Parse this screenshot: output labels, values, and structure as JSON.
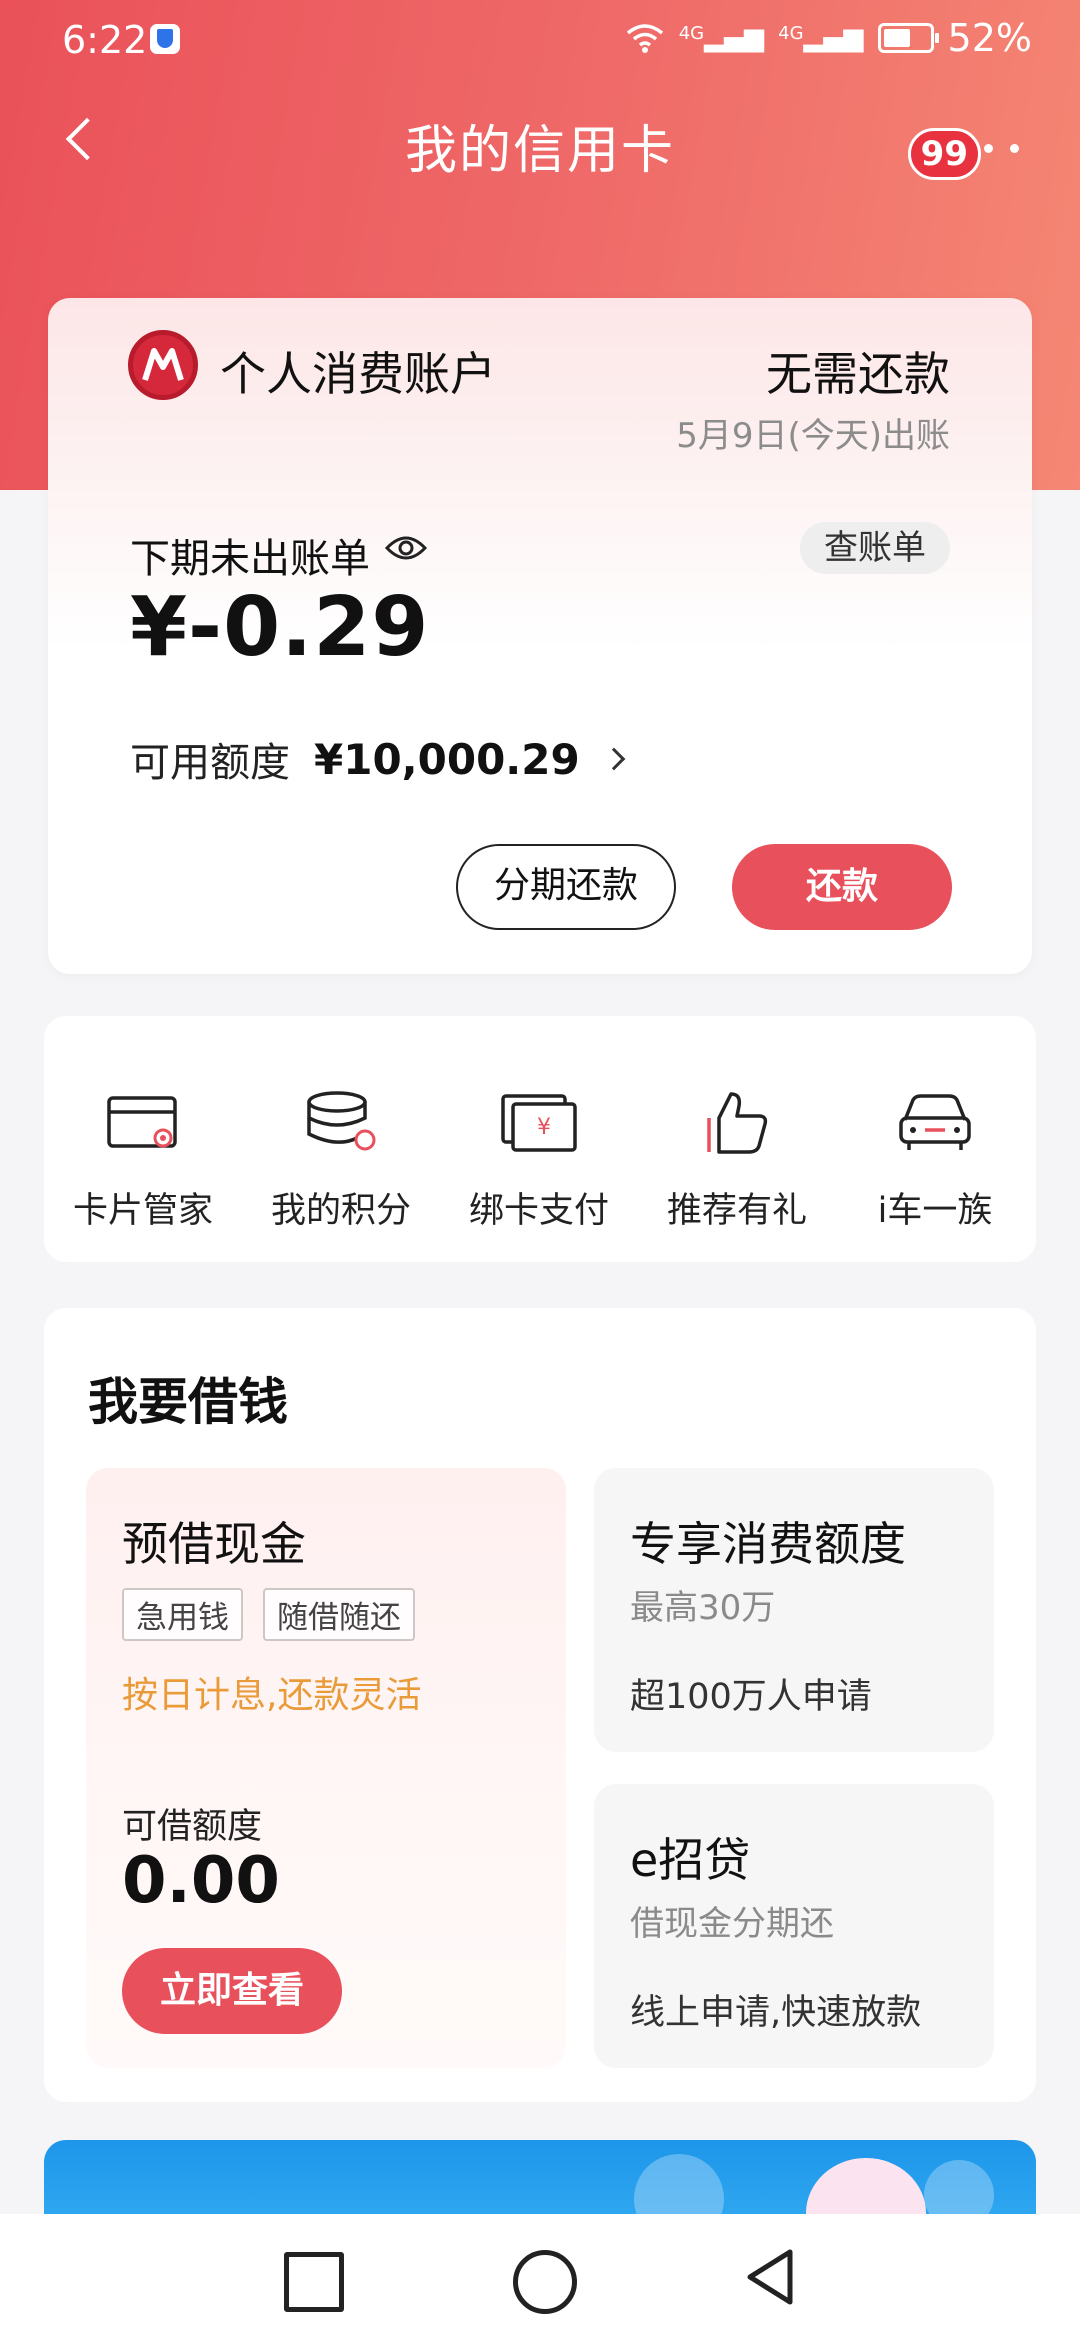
{
  "status_bar": {
    "time": "6:22",
    "network_1": "4G",
    "network_2": "4G",
    "battery_percent": "52%"
  },
  "header": {
    "title": "我的信用卡",
    "badge_count": "99"
  },
  "account": {
    "name": "个人消费账户",
    "repay_status": "无需还款",
    "bill_date": "5月9日(今天)出账",
    "unbilled_label": "下期未出账单",
    "statement_button": "查账单",
    "balance": "¥-0.29",
    "credit_label": "可用额度",
    "credit_value": "¥10,000.29",
    "installment_button": "分期还款",
    "repay_button": "还款"
  },
  "quick_actions": [
    {
      "label": "卡片管家",
      "icon": "card-manager-icon"
    },
    {
      "label": "我的积分",
      "icon": "points-icon"
    },
    {
      "label": "绑卡支付",
      "icon": "bind-card-pay-icon"
    },
    {
      "label": "推荐有礼",
      "icon": "thumbs-up-icon"
    },
    {
      "label": "i车一族",
      "icon": "car-icon"
    }
  ],
  "borrow": {
    "title": "我要借钱",
    "cash": {
      "title": "预借现金",
      "tags": [
        "急用钱",
        "随借随还"
      ],
      "slogan": "按日计息,还款灵活",
      "limit_label": "可借额度",
      "limit_value": "0.00",
      "button": "立即查看"
    },
    "consumption": {
      "title": "专享消费额度",
      "subtitle": "最高30万",
      "desc": "超100万人申请"
    },
    "eloan": {
      "title": "e招贷",
      "subtitle": "借现金分期还",
      "desc": "线上申请,快速放款"
    }
  },
  "colors": {
    "accent": "#e8505b",
    "header_start": "#ea5159",
    "header_end": "#f58774",
    "slogan": "#e99b3a",
    "banner": "#1d96ea"
  }
}
